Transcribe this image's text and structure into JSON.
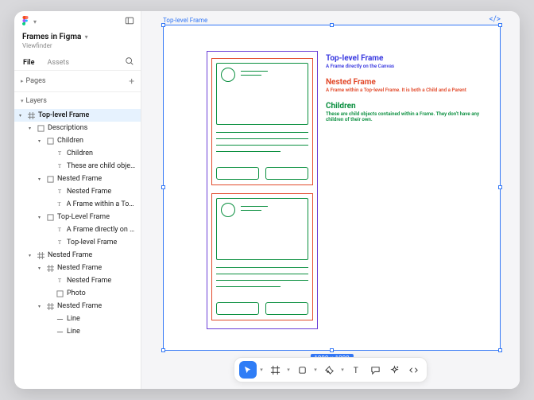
{
  "doc": {
    "name": "Frames in Figma",
    "subtitle": "Viewfinder"
  },
  "panel_tabs": {
    "file": "File",
    "assets": "Assets"
  },
  "sections": {
    "pages": "Pages",
    "layers": "Layers"
  },
  "tree": [
    {
      "d": 0,
      "ico": "hash",
      "tri": "down",
      "label": "Top-level Frame",
      "sel": true
    },
    {
      "d": 1,
      "ico": "frame",
      "tri": "down",
      "label": "Descriptions"
    },
    {
      "d": 2,
      "ico": "frame",
      "tri": "down",
      "label": "Children"
    },
    {
      "d": 3,
      "ico": "text",
      "tri": "",
      "label": "Children"
    },
    {
      "d": 3,
      "ico": "text",
      "tri": "",
      "label": "These are child obje…"
    },
    {
      "d": 2,
      "ico": "frame",
      "tri": "down",
      "label": "Nested Frame"
    },
    {
      "d": 3,
      "ico": "text",
      "tri": "",
      "label": "Nested Frame"
    },
    {
      "d": 3,
      "ico": "text",
      "tri": "",
      "label": "A Frame within a Top…"
    },
    {
      "d": 2,
      "ico": "frame",
      "tri": "down",
      "label": "Top-Level Frame"
    },
    {
      "d": 3,
      "ico": "text",
      "tri": "",
      "label": "A Frame directly on t…"
    },
    {
      "d": 3,
      "ico": "text",
      "tri": "",
      "label": "Top-level Frame"
    },
    {
      "d": 1,
      "ico": "hash",
      "tri": "down",
      "label": "Nested Frame"
    },
    {
      "d": 2,
      "ico": "hash",
      "tri": "down",
      "label": "Nested Frame"
    },
    {
      "d": 3,
      "ico": "text",
      "tri": "",
      "label": "Nested Frame"
    },
    {
      "d": 3,
      "ico": "frame",
      "tri": "",
      "label": "Photo"
    },
    {
      "d": 2,
      "ico": "hash",
      "tri": "down",
      "label": "Nested Frame"
    },
    {
      "d": 3,
      "ico": "line",
      "tri": "",
      "label": "Line"
    },
    {
      "d": 3,
      "ico": "line",
      "tri": "",
      "label": "Line"
    }
  ],
  "canvas": {
    "frame_label": "Top-level Frame",
    "dimensions": "1000 × 1000",
    "descriptions": [
      {
        "title": "Top-level Frame",
        "sub": "A Frame directly on the Canvas",
        "cls": "t-blue"
      },
      {
        "title": "Nested Frame",
        "sub": "A Frame within a Top-level Frame. It is both a Child and a Parent",
        "cls": "t-red"
      },
      {
        "title": "Children",
        "sub": "These are child objects  contained within a Frame. They don't have any children of their own.",
        "cls": "t-green"
      }
    ]
  },
  "toolbar": [
    "move",
    "frame",
    "shape",
    "pen",
    "text",
    "comment",
    "actions",
    "dev"
  ]
}
